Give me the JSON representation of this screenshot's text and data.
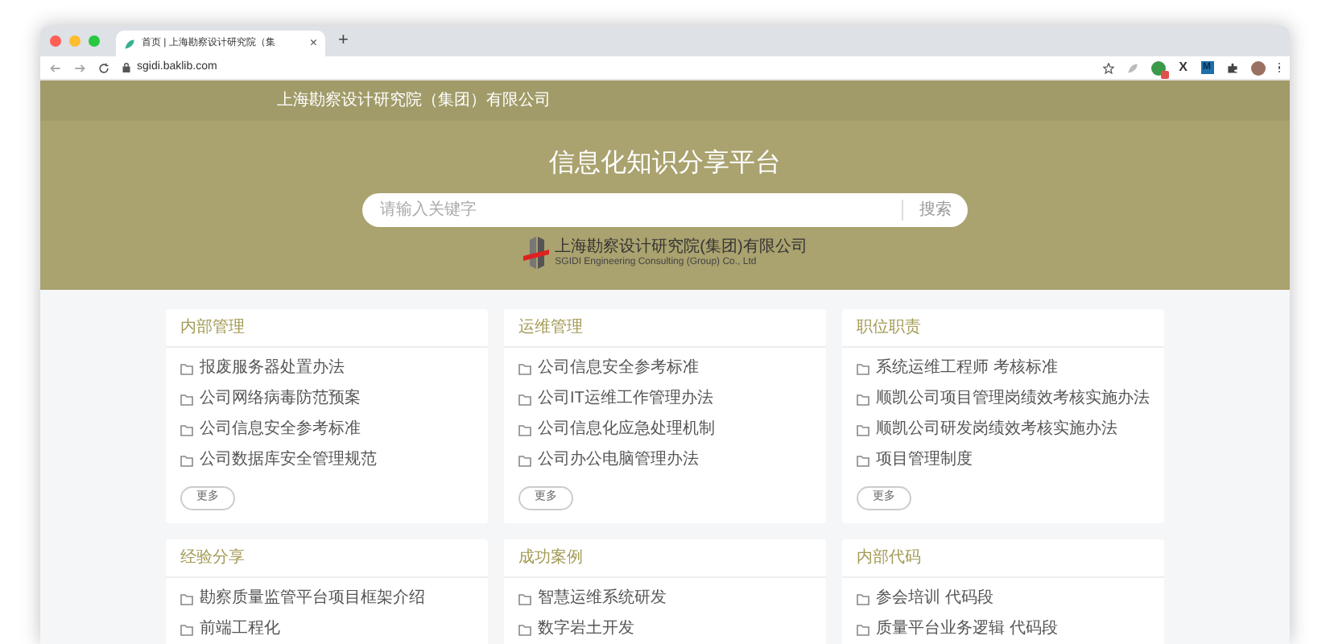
{
  "browser": {
    "tab_title": "首页 | 上海勘察设计研究院（集",
    "tab_close": "×",
    "new_tab": "+",
    "url": "sgidi.baklib.com",
    "extensions": [
      {
        "kind": "leaf"
      },
      {
        "kind": "badge"
      },
      {
        "kind": "letter",
        "label": "X"
      },
      {
        "kind": "tile",
        "label": "M"
      },
      {
        "kind": "puzzle"
      }
    ]
  },
  "site_header": {
    "title": "上海勘察设计研究院（集团）有限公司"
  },
  "hero": {
    "title": "信息化知识分享平台",
    "search": {
      "placeholder": "请输入关键字",
      "button": "搜索"
    },
    "logo": {
      "name": "上海勘察设计研究院(集团)有限公司",
      "subtitle": "SGIDI Engineering Consulting (Group) Co., Ltd"
    }
  },
  "sections": [
    {
      "title": "内部管理",
      "items": [
        "报废服务器处置办法",
        "公司网络病毒防范预案",
        "公司信息安全参考标准",
        "公司数据库安全管理规范"
      ],
      "more": "更多"
    },
    {
      "title": "运维管理",
      "items": [
        "公司信息安全参考标准",
        "公司IT运维工作管理办法",
        "公司信息化应急处理机制",
        "公司办公电脑管理办法"
      ],
      "more": "更多"
    },
    {
      "title": "职位职责",
      "items": [
        "系统运维工程师 考核标准",
        "顺凯公司项目管理岗绩效考核实施办法",
        "顺凯公司研发岗绩效考核实施办法",
        "项目管理制度"
      ],
      "more": "更多"
    },
    {
      "title": "经验分享",
      "items": [
        "勘察质量监管平台项目框架介绍",
        "前端工程化"
      ]
    },
    {
      "title": "成功案例",
      "items": [
        "智慧运维系统研发",
        "数字岩土开发"
      ]
    },
    {
      "title": "内部代码",
      "items": [
        "参会培训 代码段",
        "质量平台业务逻辑 代码段"
      ]
    }
  ]
}
